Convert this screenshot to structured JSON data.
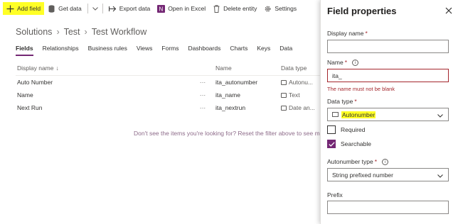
{
  "toolbar": {
    "add_field": "Add field",
    "get_data": "Get data",
    "export_data": "Export data",
    "open_in_excel": "Open in Excel",
    "delete_entity": "Delete entity",
    "settings": "Settings",
    "accent": "#742774",
    "highlight": "#ffff26"
  },
  "breadcrumb": [
    "Solutions",
    "Test",
    "Test Workflow"
  ],
  "tabs": [
    "Fields",
    "Relationships",
    "Business rules",
    "Views",
    "Forms",
    "Dashboards",
    "Charts",
    "Keys",
    "Data"
  ],
  "table": {
    "headers": {
      "display_name": "Display name",
      "sort_arrow": "↓",
      "name": "Name",
      "data_type": "Data type"
    },
    "rows": [
      {
        "display": "Auto Number",
        "more": "···",
        "name": "ita_autonumber",
        "type": "Autonu..."
      },
      {
        "display": "Name",
        "more": "···",
        "name": "ita_name",
        "type": "Text"
      },
      {
        "display": "Next Run",
        "more": "···",
        "name": "ita_nextrun",
        "type": "Date an..."
      }
    ],
    "empty_message": "Don't see the items you're looking for? Reset the filter above to see more"
  },
  "panel": {
    "title": "Field properties",
    "display_name_label": "Display name",
    "display_name_value": "",
    "name_label": "Name",
    "name_value": "ita_",
    "name_error": "The name must not be blank",
    "data_type_label": "Data type",
    "data_type_value": "Autonumber",
    "required_label": "Required",
    "required_checked": false,
    "searchable_label": "Searchable",
    "searchable_checked": true,
    "autonumber_type_label": "Autonumber type",
    "autonumber_type_value": "String prefixed number",
    "prefix_label": "Prefix",
    "prefix_value": "",
    "required_marker": "*",
    "info_glyph": "i",
    "error_color": "#a4262c"
  }
}
